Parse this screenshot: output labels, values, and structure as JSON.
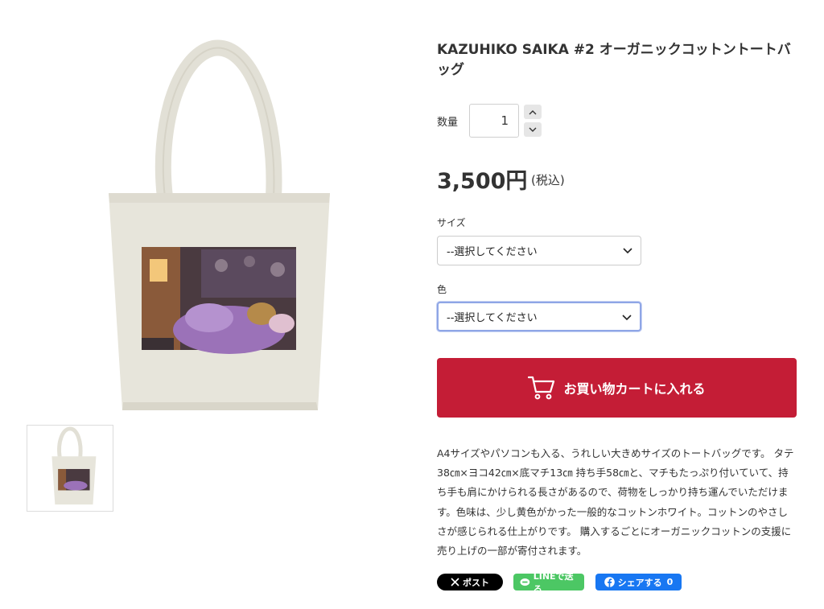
{
  "product": {
    "title": "KAZUHIKO SAIKA #2 オーガニックコットントートバッグ",
    "price": "3,500円",
    "tax_note": "(税込)"
  },
  "quantity": {
    "label": "数量",
    "value": "1"
  },
  "options": {
    "size_label": "サイズ",
    "size_value": "--選択してください",
    "color_label": "色",
    "color_value": "--選択してください"
  },
  "cart": {
    "label": "お買い物カートに入れる",
    "button_color": "#c41d36"
  },
  "description": "A4サイズやパソコンも入る、うれしい大きめサイズのトートバッグです。 タテ38㎝×ヨコ42㎝×底マチ13㎝ 持ち手58㎝と、マチもたっぷり付いていて、持ち手も肩にかけられる長さがあるので、荷物をしっかり持ち運んでいただけます。色味は、少し黄色がかった一般的なコットンホワイト。コットンのやさしさが感じられる仕上がりです。 購入するごとにオーガニックコットンの支援に売り上げの一部が寄付されます。",
  "share": {
    "x_label": "ポスト",
    "line_label": "LINEで送る",
    "fb_label": "シェアする",
    "fb_count": "0"
  },
  "icons": {
    "quantity_up": "chevron-up-icon",
    "quantity_down": "chevron-down-icon",
    "select_arrow": "chevron-down-icon",
    "cart": "cart-icon",
    "x": "x-logo-icon",
    "line": "line-logo-icon",
    "facebook": "facebook-logo-icon"
  }
}
